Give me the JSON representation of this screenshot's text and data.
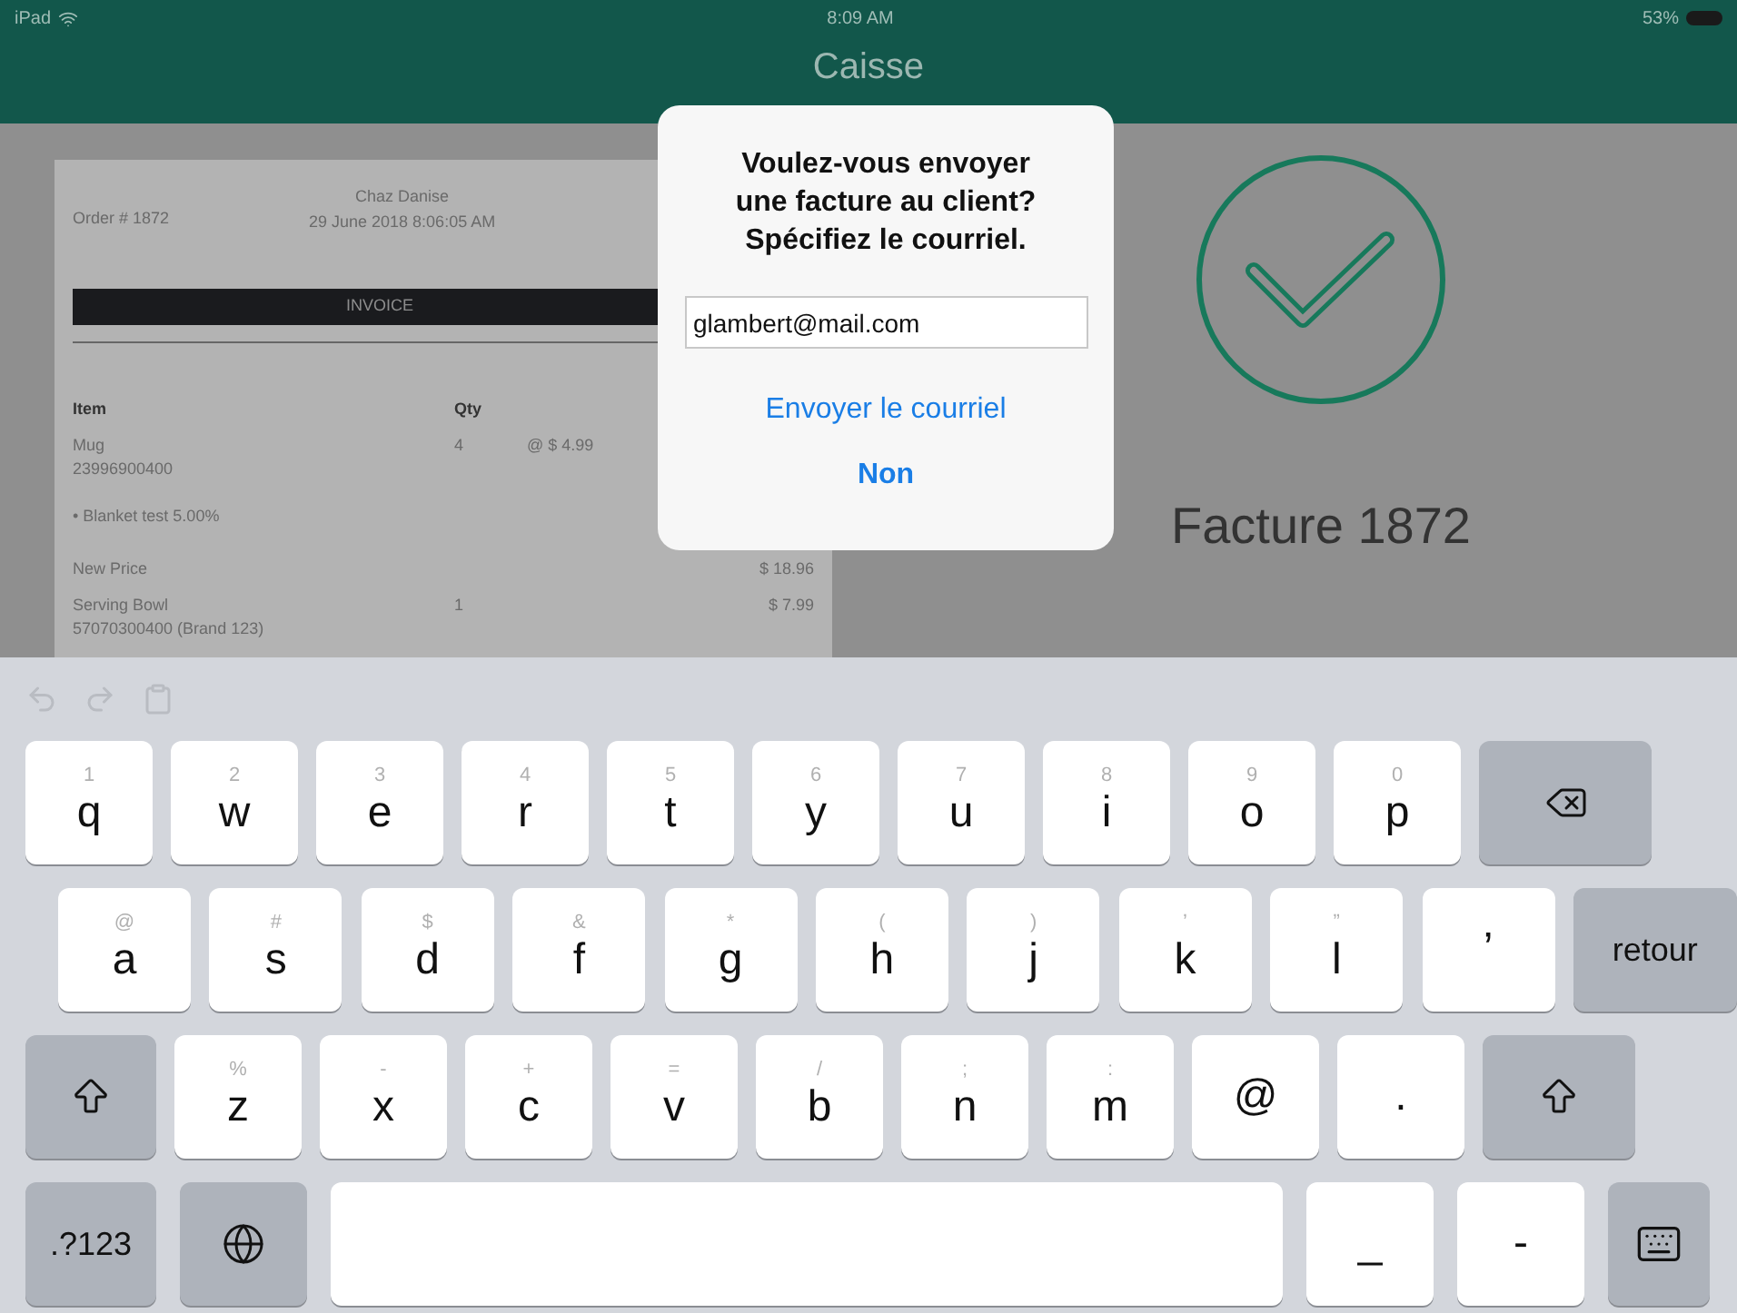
{
  "status_bar": {
    "carrier": "iPad",
    "time": "8:09 AM",
    "battery": "53%"
  },
  "nav": {
    "title": "Caisse"
  },
  "receipt": {
    "store": "Chaz Danise",
    "order": "Order # 1872",
    "date": "29 June 2018 8:06:05 AM",
    "banner": "INVOICE",
    "columns": [
      "Item",
      "Qty"
    ],
    "rows": [
      {
        "kind": "item",
        "name": "Mug",
        "code": "23996900400",
        "qty": "4",
        "price": "@ $ 4.99"
      },
      {
        "kind": "note",
        "name": "• Blanket test 5.00%"
      },
      {
        "kind": "total",
        "name": "New Price",
        "price": "$ 18.96"
      },
      {
        "kind": "item",
        "name": "Serving Bowl",
        "code": "57070300400 (Brand 123)",
        "qty": "1",
        "price": "$ 7.99"
      }
    ]
  },
  "result": {
    "title": "Facture 1872"
  },
  "dialog": {
    "message": "Voulez-vous envoyer une facture au client? Spécifiez le courriel.",
    "email": {
      "value": "glambert@mail.com"
    },
    "actions": [
      {
        "label": "Envoyer le courriel",
        "bold": false
      },
      {
        "label": "Non",
        "bold": true
      }
    ]
  },
  "keyboard": {
    "rows": [
      [
        {
          "kind": "letter",
          "label": "q",
          "hint": "1"
        },
        {
          "kind": "letter",
          "label": "w",
          "hint": "2"
        },
        {
          "kind": "letter",
          "label": "e",
          "hint": "3"
        },
        {
          "kind": "letter",
          "label": "r",
          "hint": "4"
        },
        {
          "kind": "letter",
          "label": "t",
          "hint": "5"
        },
        {
          "kind": "letter",
          "label": "y",
          "hint": "6"
        },
        {
          "kind": "letter",
          "label": "u",
          "hint": "7"
        },
        {
          "kind": "letter",
          "label": "i",
          "hint": "8"
        },
        {
          "kind": "letter",
          "label": "o",
          "hint": "9"
        },
        {
          "kind": "letter",
          "label": "p",
          "hint": "0"
        },
        {
          "kind": "backspace"
        }
      ],
      [
        {
          "kind": "letter",
          "label": "a",
          "hint": "@"
        },
        {
          "kind": "letter",
          "label": "s",
          "hint": "#"
        },
        {
          "kind": "letter",
          "label": "d",
          "hint": "$"
        },
        {
          "kind": "letter",
          "label": "f",
          "hint": "&"
        },
        {
          "kind": "letter",
          "label": "g",
          "hint": "*"
        },
        {
          "kind": "letter",
          "label": "h",
          "hint": "("
        },
        {
          "kind": "letter",
          "label": "j",
          "hint": ")"
        },
        {
          "kind": "letter",
          "label": "k",
          "hint": "’"
        },
        {
          "kind": "letter",
          "label": "l",
          "hint": "”"
        },
        {
          "kind": "letter",
          "label": "’"
        },
        {
          "kind": "return",
          "label": "retour"
        }
      ],
      [
        {
          "kind": "shift"
        },
        {
          "kind": "letter",
          "label": "z",
          "hint": "%"
        },
        {
          "kind": "letter",
          "label": "x",
          "hint": "-"
        },
        {
          "kind": "letter",
          "label": "c",
          "hint": "+"
        },
        {
          "kind": "letter",
          "label": "v",
          "hint": "="
        },
        {
          "kind": "letter",
          "label": "b",
          "hint": "/"
        },
        {
          "kind": "letter",
          "label": "n",
          "hint": ";"
        },
        {
          "kind": "letter",
          "label": "m",
          "hint": ":"
        },
        {
          "kind": "letter",
          "label": "@"
        },
        {
          "kind": "letter",
          "label": "."
        },
        {
          "kind": "shift"
        }
      ],
      [
        {
          "kind": "numbers",
          "label": ".?123"
        },
        {
          "kind": "globe"
        },
        {
          "kind": "space"
        },
        {
          "kind": "letter",
          "label": "_"
        },
        {
          "kind": "letter",
          "label": "-"
        },
        {
          "kind": "dismiss"
        }
      ]
    ]
  }
}
